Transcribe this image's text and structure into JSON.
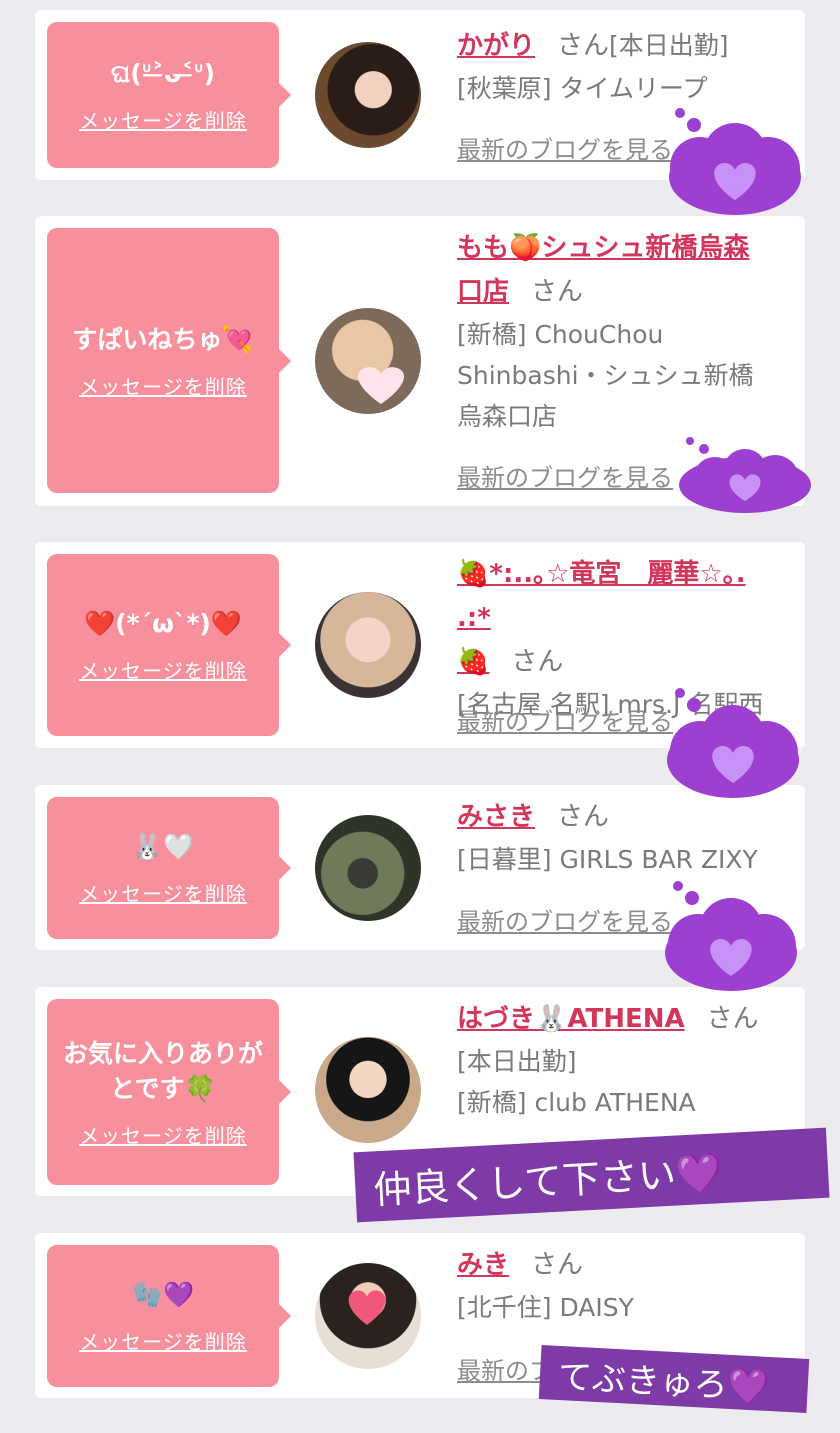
{
  "colors": {
    "bubble": "#f7909c",
    "name": "#d2365a",
    "cloud": "#9d3fd0",
    "heart": "#b678f0",
    "sticker": "#7e3aa7"
  },
  "delete_label": "メッセージを削除",
  "blog_label": "最新のブログを見る",
  "items": [
    {
      "message": "ଘ(ᐡ˃̶ᴗ˂̶ᐡ)",
      "name": "かがり",
      "san": "さん",
      "lines": [
        "[本日出勤]",
        "[秋葉原] タイムリープ"
      ]
    },
    {
      "message": "すぱいねちゅ💘",
      "name_lines": [
        "もも🍑シュシュ新橋烏森",
        "口店"
      ],
      "san": "さん",
      "lines": [
        "[新橋] ChouChou",
        "Shinbashi・シュシュ新橋",
        "烏森口店"
      ]
    },
    {
      "message": "❤️(*´ω`*)❤️",
      "name_lines": [
        "🍓*:..｡☆竜宮　麗華☆｡. .:*",
        "🍓"
      ],
      "san": "さん",
      "lines": [
        "[名古屋 名駅] mrs.J 名駅西"
      ]
    },
    {
      "message": "🐰🤍",
      "name": "みさき",
      "san": "さん",
      "lines": [
        "[日暮里] GIRLS BAR ZIXY"
      ]
    },
    {
      "message_lines": [
        "お気に入りありが",
        "とです🍀"
      ],
      "name": "はづき🐰ATHENA",
      "san": "さん",
      "lines": [
        "[本日出勤]",
        "[新橋] club ATHENA"
      ]
    },
    {
      "message": "🧤💜",
      "name": "みき",
      "san": "さん",
      "lines": [
        "[北千住] DAISY"
      ]
    }
  ],
  "stickers": {
    "s1": "仲良くして下さい💜",
    "s2": "てぶきゅろ💜"
  }
}
